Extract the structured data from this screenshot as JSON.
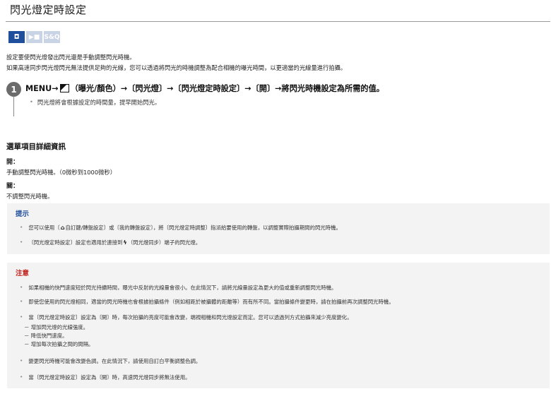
{
  "page": {
    "title": "閃光燈定時設定"
  },
  "mode_icons": [
    {
      "label": "◘",
      "name": "camera-mode-icon",
      "active": true
    },
    {
      "label": "▶■",
      "name": "movie-mode-icon",
      "active": false
    },
    {
      "label": "S&Q",
      "name": "sq-mode-icon",
      "active": false
    }
  ],
  "intro": {
    "line1": "設定要使閃光燈發出閃光還是手動調整閃光時機。",
    "line2": "如果高速同步閃光燈閃光無法提供足夠的光線，您可以透過將閃光的時機調整為配合相機的曝光時間，以更適當的光線量進行拍攝。"
  },
  "step": {
    "number": "1",
    "prefix": "MENU→",
    "suffix": "（曝光/顏色）→〔閃光燈〕→〔閃光燈定時設定〕→〔開〕→將閃光時機設定為所需的值。",
    "bullet": "閃光燈將會根據設定的時間量，提早開始閃光。"
  },
  "details": {
    "title": "選單項目詳細資訊",
    "options": [
      {
        "label": "開：",
        "desc": "手動調整閃光時機。（0微秒到1000微秒）"
      },
      {
        "label": "關：",
        "desc": "不調整閃光時機。"
      }
    ]
  },
  "hint": {
    "heading": "提示",
    "items": [
      {
        "pre": "您可以使用〔",
        "icon": "⌂",
        "post": "自訂鍵/轉盤設定〕或〔我的轉盤設定〕，將〔閃光燈定時調整〕指派給要使用的轉盤，以調整實際拍攝期間的閃光時機。"
      },
      {
        "pre": "〔閃光燈定時設定〕設定也適用於連接到",
        "icon": "ϟ",
        "post": "（閃光燈同步）端子的閃光燈。"
      }
    ]
  },
  "note": {
    "heading": "注意",
    "items": [
      "如果相機的快門速度短於閃光持續時間，曝光中反射的光線量會很小。在此情況下，請將光線量設定為更大的值或重新調整閃光時機。",
      "即使您使用的閃光燈相同，適當的閃光時機也會根據拍攝條件（例如相距於被攝體的距離等）而有所不同。當拍攝條件變更時，請在拍攝前再次調整閃光時機。",
      "當〔閃光燈定時設定〕設定為〔開〕時，每次拍攝的亮度可能會改變，端視相機和閃光燈設定而定。您可以透過列方式拍攝來減少亮度變化。",
      "變更閃光時機可能會改變色調。在此情況下，請使用自訂白平衡調整色調。",
      "當〔閃光燈定時設定〕設定為〔開〕時，高速閃光燈同步將無法使用。"
    ],
    "sub_items": [
      "－ 增加閃光燈的光線強度。",
      "－ 降低快門速度。",
      "－ 增加每次拍攝之間的間隔。"
    ]
  }
}
